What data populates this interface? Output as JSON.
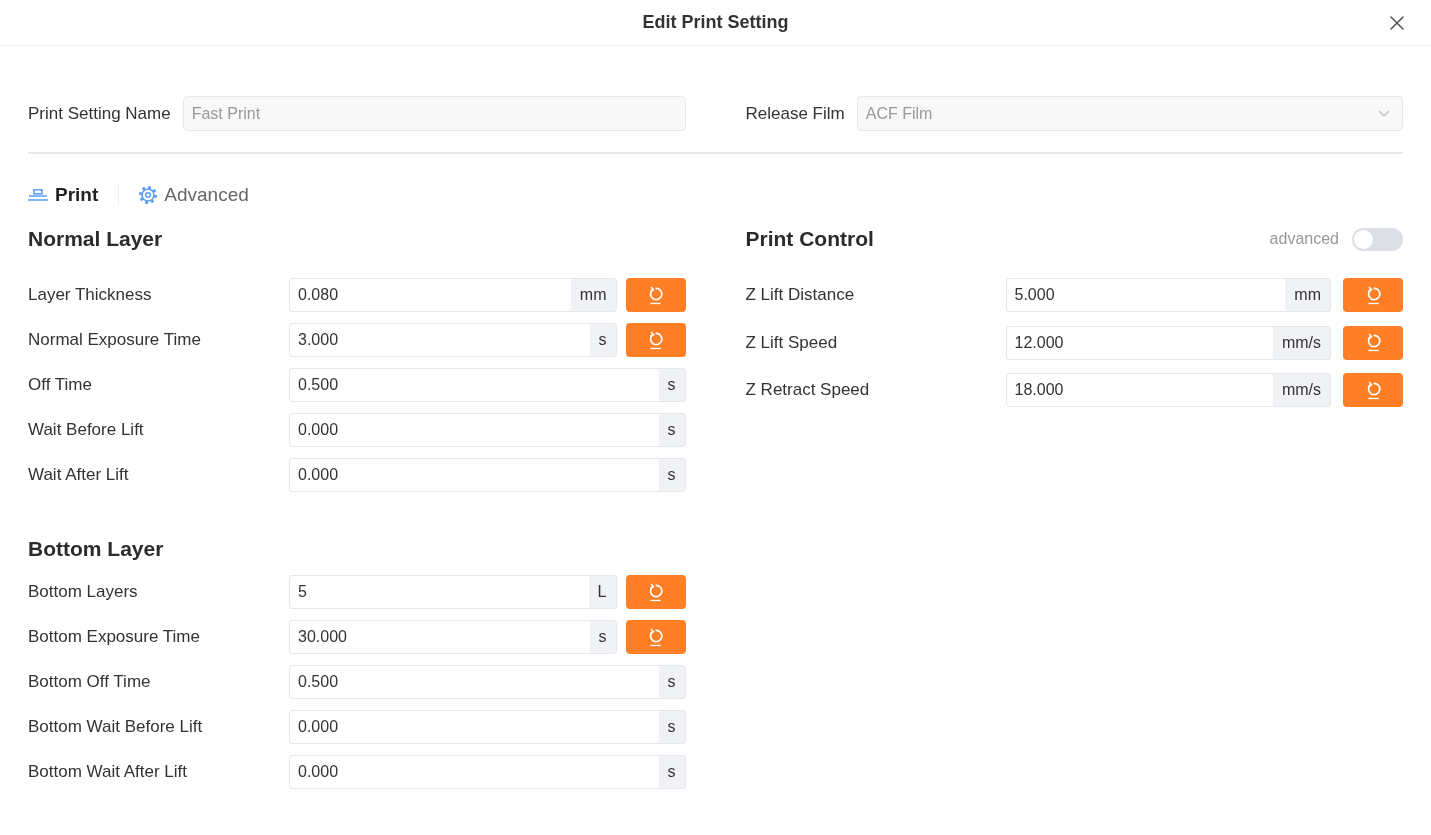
{
  "dialog": {
    "title": "Edit Print Setting"
  },
  "header_fields": [
    {
      "kind": "text",
      "label": "Print Setting Name",
      "value": "Fast Print",
      "disabled": true
    },
    {
      "kind": "select",
      "label": "Release Film",
      "value": "ACF Film",
      "disabled": true
    }
  ],
  "tabs": [
    {
      "kind": "print",
      "label": "Print",
      "selected": true
    },
    {
      "kind": "advanced",
      "label": "Advanced",
      "selected": false
    }
  ],
  "layer_sections": [
    {
      "title": "Normal Layer",
      "fields": [
        {
          "label": "Layer Thickness",
          "value": "0.080",
          "unit": "mm",
          "resettable": true
        },
        {
          "label": "Normal Exposure Time",
          "value": "3.000",
          "unit": "s",
          "resettable": true
        },
        {
          "label": "Off Time",
          "value": "0.500",
          "unit": "s",
          "resettable": false
        },
        {
          "label": "Wait Before Lift",
          "value": "0.000",
          "unit": "s",
          "resettable": false
        },
        {
          "label": "Wait After Lift",
          "value": "0.000",
          "unit": "s",
          "resettable": false
        }
      ]
    },
    {
      "title": "Bottom Layer",
      "fields": [
        {
          "label": "Bottom Layers",
          "value": "5",
          "unit": "L",
          "resettable": true
        },
        {
          "label": "Bottom Exposure Time",
          "value": "30.000",
          "unit": "s",
          "resettable": true
        },
        {
          "label": "Bottom Off Time",
          "value": "0.500",
          "unit": "s",
          "resettable": false
        },
        {
          "label": "Bottom Wait Before Lift",
          "value": "0.000",
          "unit": "s",
          "resettable": false
        },
        {
          "label": "Bottom Wait After Lift",
          "value": "0.000",
          "unit": "s",
          "resettable": false
        }
      ]
    }
  ],
  "print_control": {
    "title": "Print Control",
    "toggle": {
      "label": "advanced",
      "on": false
    },
    "fields": [
      {
        "label": "Z Lift Distance",
        "value": "5.000",
        "unit": "mm",
        "resettable": true
      },
      {
        "label": "Z Lift Speed",
        "value": "12.000",
        "unit": "mm/s",
        "resettable": true
      },
      {
        "label": "Z Retract Speed",
        "value": "18.000",
        "unit": "mm/s",
        "resettable": true
      }
    ]
  }
}
